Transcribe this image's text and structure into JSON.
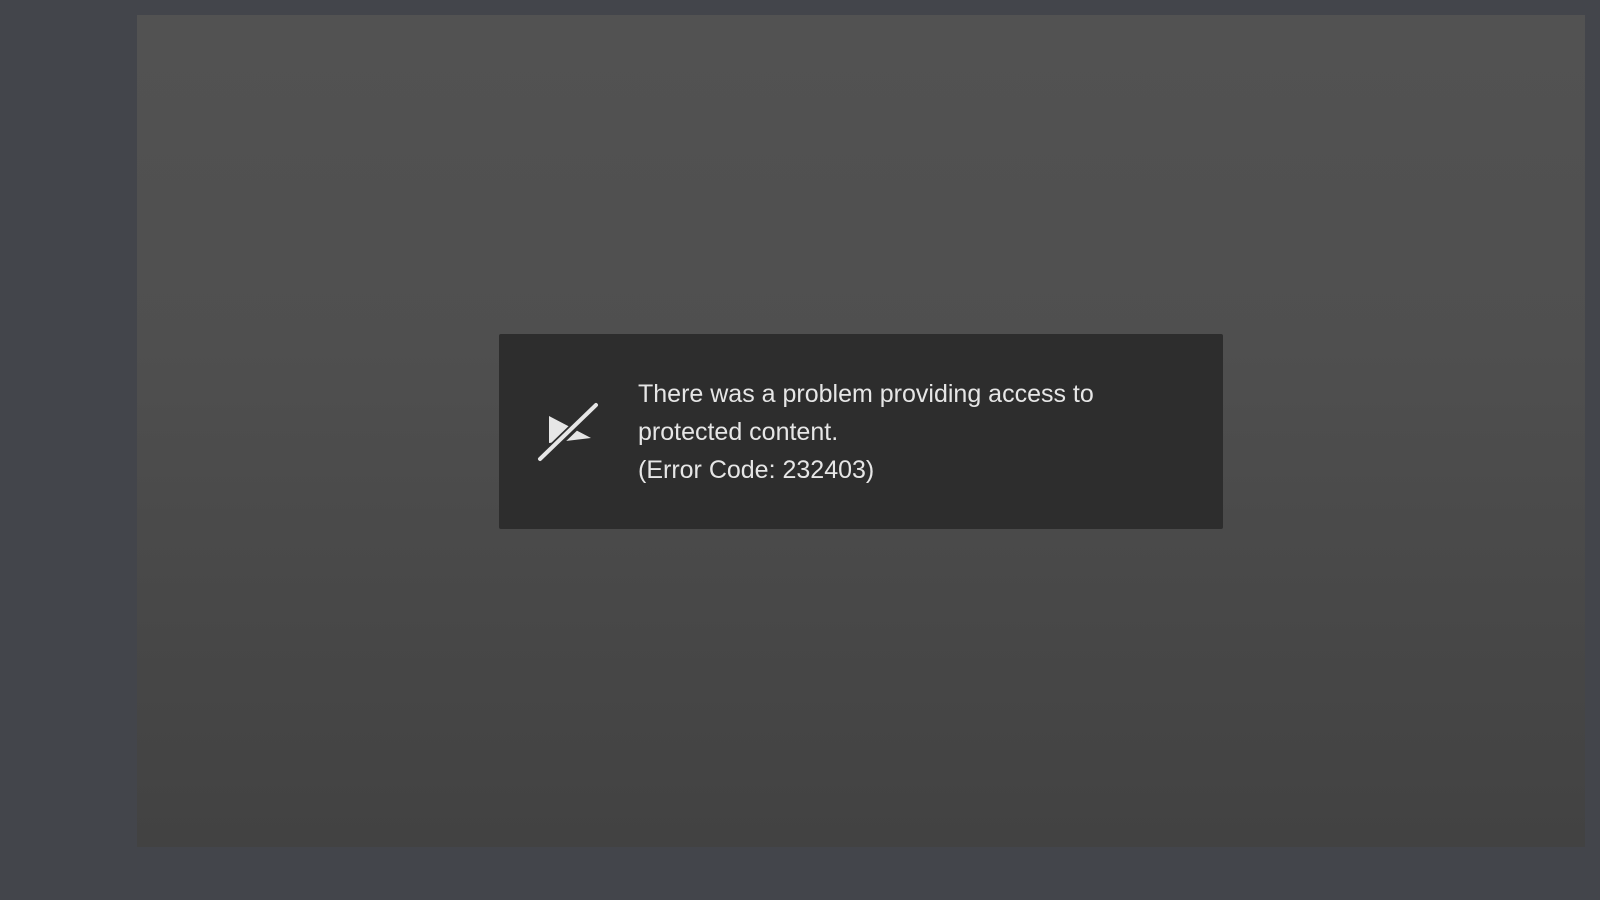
{
  "player": {
    "error": {
      "icon": "protected-content-blocked-icon",
      "message_line1": "There was a problem providing access to",
      "message_line2": "protected content.",
      "error_code": "(Error Code: 232403)"
    }
  },
  "colors": {
    "page_background": "#43454b",
    "player_background": "#4f4f4f",
    "dialog_background": "#2d2d2d",
    "text": "#e6e6e6"
  }
}
